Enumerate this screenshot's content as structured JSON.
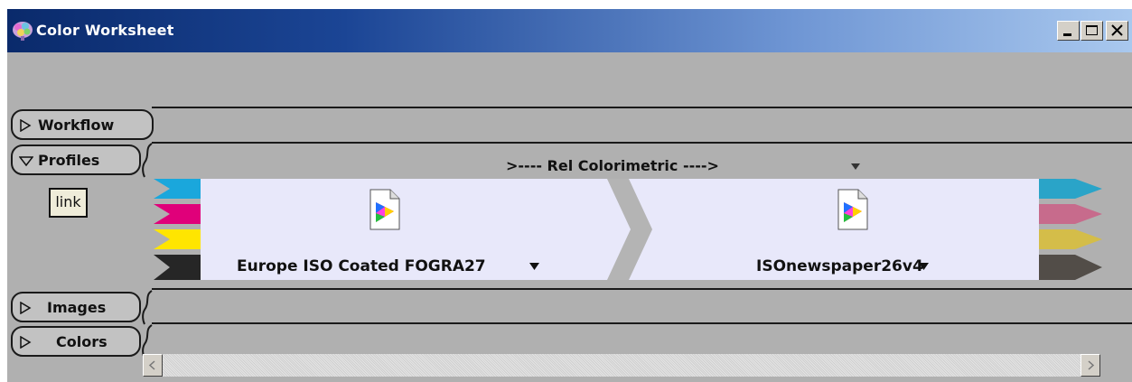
{
  "window": {
    "title": "Color Worksheet",
    "controls": [
      "minimize",
      "maximize",
      "close"
    ]
  },
  "sections": [
    {
      "label": "Workflow",
      "expanded": false
    },
    {
      "label": "Profiles",
      "expanded": true
    },
    {
      "label": "Images",
      "expanded": false
    },
    {
      "label": "Colors",
      "expanded": false
    }
  ],
  "profiles": {
    "link_label": "link",
    "rendering_intent": ">---- Rel Colorimetric ---->",
    "source_profile": "Europe ISO Coated FOGRA27",
    "destination_profile": "ISOnewspaper26v4",
    "source_channels": [
      "cyan",
      "magenta",
      "yellow",
      "black"
    ],
    "destination_channels": [
      "cyan",
      "magenta",
      "yellow",
      "black"
    ]
  },
  "colors": {
    "panel_bg": "#e8e8fa",
    "window_bg": "#b0b0b0",
    "src_cyan": "#1aa7dc",
    "src_magenta": "#e0007a",
    "src_yellow": "#ffe500",
    "src_black": "#262626",
    "dst_cyan": "#2aa4c8",
    "dst_magenta": "#c76b8c",
    "dst_yellow": "#d4bd49",
    "dst_black": "#524d48"
  },
  "icons": [
    "app-brain-icon",
    "icc-profile-icon",
    "dropdown-arrow-icon",
    "disclosure-triangle-icon",
    "scroll-left-icon",
    "scroll-right-icon"
  ]
}
